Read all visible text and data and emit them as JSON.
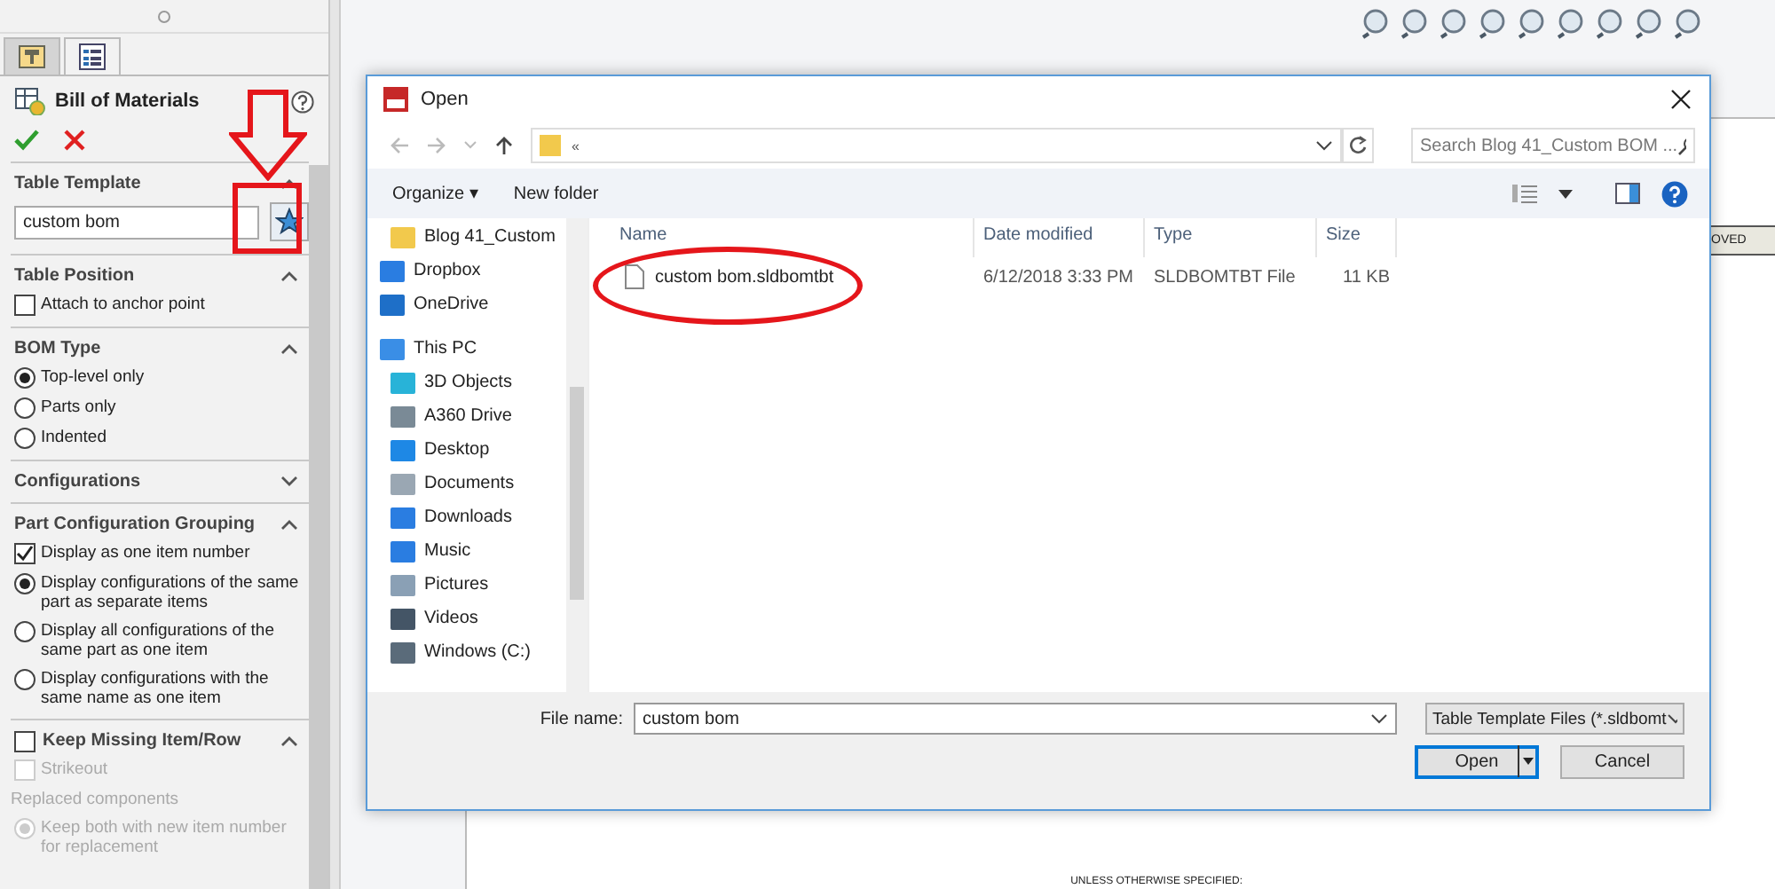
{
  "panel": {
    "tabs": [
      {
        "kind": "feature",
        "selected": false
      },
      {
        "kind": "property",
        "selected": true
      }
    ],
    "title": "Bill of Materials",
    "sections": [
      {
        "kind": "template",
        "title": "Table Template",
        "expanded": true,
        "value": "custom bom"
      },
      {
        "kind": "options",
        "title": "Table Position",
        "expanded": true,
        "options": [
          {
            "kind": "checkbox",
            "label": "Attach to anchor point",
            "checked": false
          }
        ]
      },
      {
        "kind": "options",
        "title": "BOM Type",
        "expanded": true,
        "options": [
          {
            "kind": "radio",
            "label": "Top-level only",
            "selected": true
          },
          {
            "kind": "radio",
            "label": "Parts only",
            "selected": false
          },
          {
            "kind": "radio",
            "label": "Indented",
            "selected": false
          }
        ]
      },
      {
        "kind": "options",
        "title": "Configurations",
        "expanded": false
      },
      {
        "kind": "options",
        "title": "Part Configuration Grouping",
        "expanded": true,
        "options": [
          {
            "kind": "checkbox",
            "label": "Display as one item number",
            "checked": true
          },
          {
            "kind": "radio",
            "label": "Display configurations of the same part as separate items",
            "selected": true
          },
          {
            "kind": "radio",
            "label": "Display all configurations of the same part as one item",
            "selected": false
          },
          {
            "kind": "radio",
            "label": "Display configurations with the same name as one item",
            "selected": false
          }
        ]
      },
      {
        "kind": "checkheader",
        "title": "Keep Missing Item/Row",
        "checked": false,
        "expanded": true,
        "options": [
          {
            "kind": "checkbox",
            "label": "Strikeout",
            "checked": false,
            "disabled": true
          },
          {
            "kind": "note",
            "label": "Replaced components",
            "disabled": true
          },
          {
            "kind": "radio",
            "label": "Keep both with new item number for replacement",
            "selected": true,
            "disabled": true
          }
        ]
      }
    ]
  },
  "drawing": {
    "labels": [
      "OVED",
      "UNLESS OTHERWISE SPECIFIED:"
    ]
  },
  "dialog": {
    "title": "Open",
    "address": "«",
    "search": {
      "placeholder": "Search Blog 41_Custom BOM ..."
    },
    "toolbar": [
      "Organize ▾",
      "New folder"
    ],
    "nav": [
      {
        "kind": "folder",
        "label": "Blog 41_Custom"
      },
      {
        "kind": "dropbox",
        "label": "Dropbox"
      },
      {
        "kind": "cloud",
        "label": "OneDrive"
      },
      {
        "kind": "pc",
        "label": "This PC",
        "children": [
          {
            "kind": "cube",
            "label": "3D Objects"
          },
          {
            "kind": "drive",
            "label": "A360 Drive"
          },
          {
            "kind": "desktop",
            "label": "Desktop"
          },
          {
            "kind": "docs",
            "label": "Documents"
          },
          {
            "kind": "download",
            "label": "Downloads"
          },
          {
            "kind": "music",
            "label": "Music"
          },
          {
            "kind": "pictures",
            "label": "Pictures"
          },
          {
            "kind": "videos",
            "label": "Videos"
          },
          {
            "kind": "disk",
            "label": "Windows (C:)"
          }
        ]
      }
    ],
    "columns": [
      "Name",
      "Date modified",
      "Type",
      "Size"
    ],
    "rows": [
      {
        "cells": [
          "custom bom.sldbomtbt",
          "6/12/2018 3:33 PM",
          "SLDBOMTBT File",
          "11 KB"
        ]
      }
    ],
    "file_name": {
      "label": "File name:",
      "value": "custom bom"
    },
    "filter": "Table Template Files (*.sldbomt",
    "buttons": [
      "Open",
      "Cancel"
    ]
  }
}
